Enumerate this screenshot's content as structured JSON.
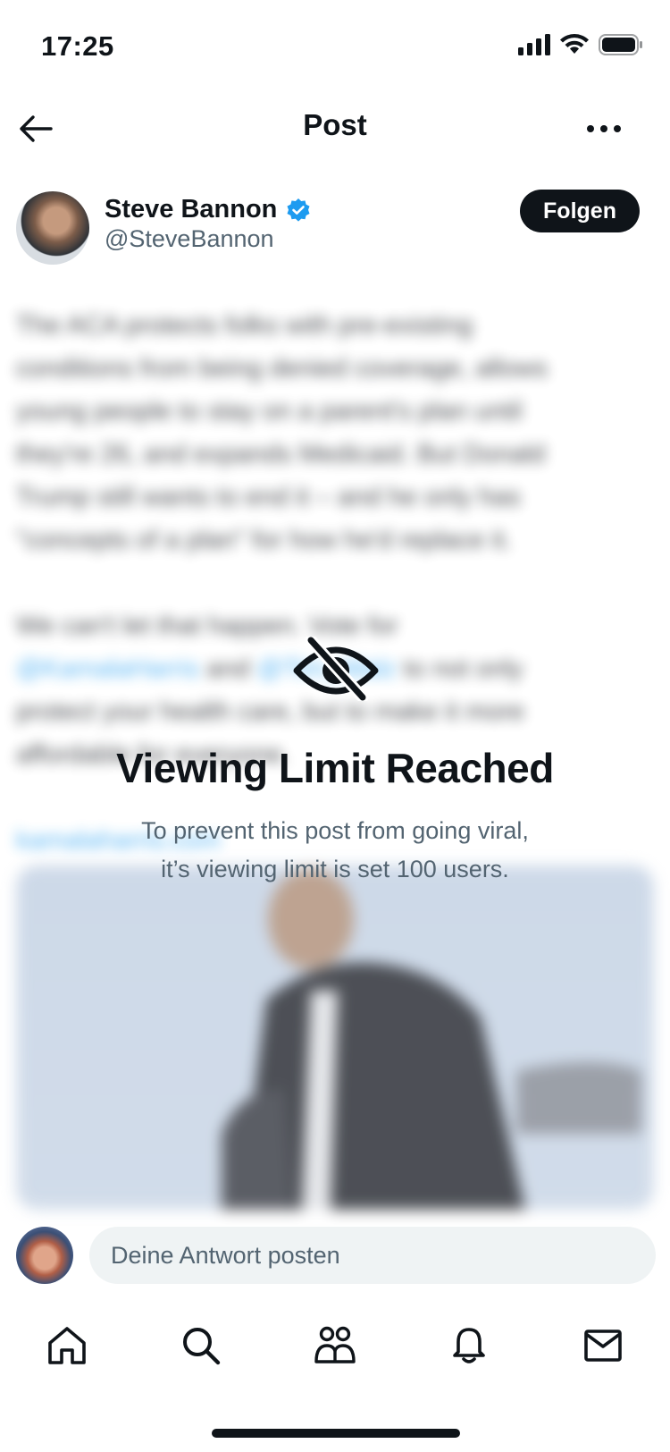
{
  "status_bar": {
    "time": "17:25"
  },
  "header": {
    "title": "Post"
  },
  "post": {
    "author_name": "Steve Bannon",
    "author_handle": "@SteveBannon",
    "follow_label": "Folgen",
    "text_paragraph_1": "The ACA protects folks with pre-existing\nconditions from being denied coverage, allows\nyoung people to stay on a parent's plan until\nthey're 26, and expands Medicaid. But Donald\nTrump still wants to end it – and he only has\n\"concepts of a plan\" for how he'd replace it.",
    "text_paragraph_2_start": "We can't let that happen. Vote for",
    "link_1": "@KamalaHarris",
    "text_and": " and ",
    "link_2": "@Tim_Walz",
    "text_paragraph_2_end": " to not only\nprotect your health care, but to make it more\naffordable for everyone.",
    "link_3": "kamalaharris.com"
  },
  "overlay": {
    "title": "Viewing Limit Reached",
    "message": "To prevent this post from going viral,\nit’s viewing limit is set 100 users."
  },
  "reply": {
    "placeholder": "Deine Antwort posten"
  },
  "tabs": [
    {
      "name": "home"
    },
    {
      "name": "search"
    },
    {
      "name": "communities"
    },
    {
      "name": "notifications"
    },
    {
      "name": "messages"
    }
  ],
  "colors": {
    "accent": "#1d9bf0",
    "text": "#0f1419",
    "secondary": "#536471",
    "verified": "#1d9bf0"
  }
}
